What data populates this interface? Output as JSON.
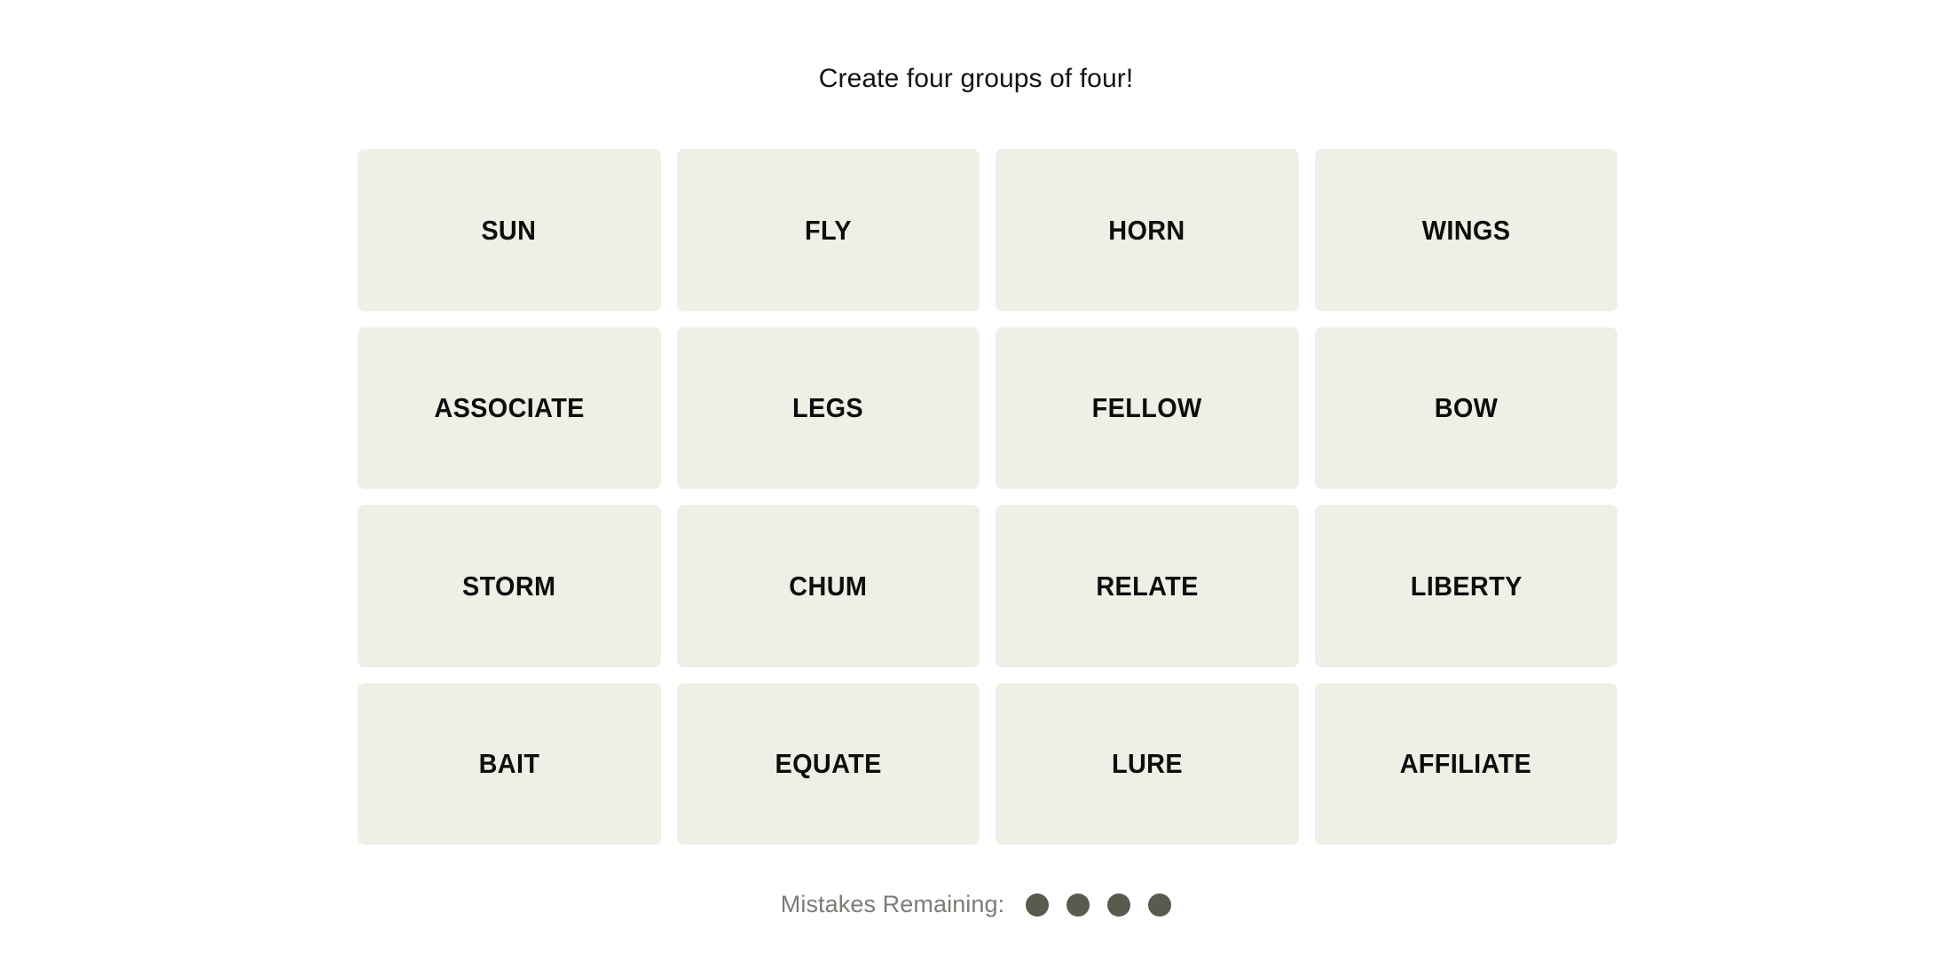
{
  "page": {
    "background_color": "#ffffff"
  },
  "header": {
    "instruction": "Create four groups of four!",
    "text_color": "#121212"
  },
  "board": {
    "rows": 4,
    "columns": 4,
    "tile_color": "#efefe6",
    "tile_text_color": "#0d0d0d",
    "tiles": [
      {
        "word": "SUN"
      },
      {
        "word": "FLY"
      },
      {
        "word": "HORN"
      },
      {
        "word": "WINGS"
      },
      {
        "word": "ASSOCIATE"
      },
      {
        "word": "LEGS"
      },
      {
        "word": "FELLOW"
      },
      {
        "word": "BOW"
      },
      {
        "word": "STORM"
      },
      {
        "word": "CHUM"
      },
      {
        "word": "RELATE"
      },
      {
        "word": "LIBERTY"
      },
      {
        "word": "BAIT"
      },
      {
        "word": "EQUATE"
      },
      {
        "word": "LURE"
      },
      {
        "word": "AFFILIATE"
      }
    ]
  },
  "mistakes": {
    "label": "Mistakes Remaining:",
    "label_color": "#7c7c77",
    "remaining": 4,
    "dot_color": "#5a5a4e",
    "dots": [
      {
        "state": "remaining"
      },
      {
        "state": "remaining"
      },
      {
        "state": "remaining"
      },
      {
        "state": "remaining"
      }
    ]
  }
}
